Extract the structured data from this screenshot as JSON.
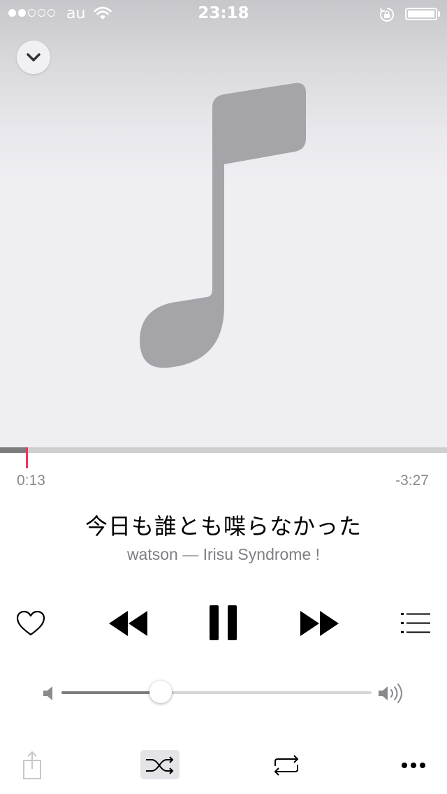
{
  "status_bar": {
    "carrier": "au",
    "time": "23:18",
    "signal_strength": 2,
    "signal_max": 5,
    "battery_level": 1.0
  },
  "now_playing": {
    "elapsed": "0:13",
    "remaining": "-3:27",
    "progress": 0.059,
    "title": "今日も誰とも喋らなかった",
    "subtitle": "watson — Irisu Syndrome !",
    "accent_color": "#f0325d"
  },
  "volume": {
    "level": 0.32
  },
  "icons": {
    "dismiss": "chevron-down-icon",
    "artwork": "music-note-icon",
    "love": "heart-icon",
    "previous": "rewind-icon",
    "play_pause": "pause-icon",
    "next": "fast-forward-icon",
    "up_next": "list-icon",
    "share": "share-icon",
    "shuffle": "shuffle-icon",
    "repeat": "repeat-icon",
    "more": "more-icon"
  }
}
